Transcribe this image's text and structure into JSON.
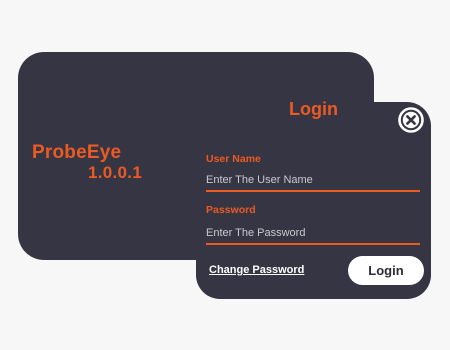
{
  "app": {
    "name": "ProbeEye",
    "version": "1.0.0.1"
  },
  "login": {
    "title": "Login",
    "username_label": "User Name",
    "username_placeholder": "Enter The User Name",
    "username_value": "",
    "password_label": "Password",
    "password_placeholder": "Enter The Password",
    "password_value": "",
    "change_password_label": "Change Password",
    "login_button_label": "Login"
  },
  "icons": {
    "close": "close-circle-x-icon"
  },
  "colors": {
    "panel": "#363543",
    "accent": "#ec5a24",
    "background": "#f7f7f8",
    "button": "#ffffff"
  }
}
